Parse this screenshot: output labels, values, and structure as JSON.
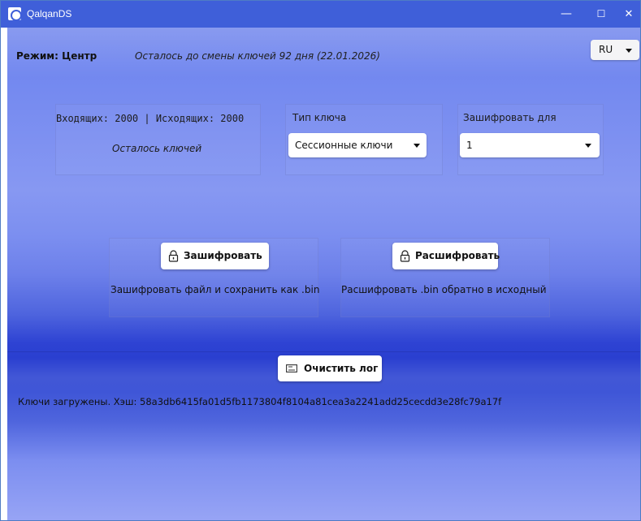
{
  "window": {
    "title": "QalqanDS",
    "controls": {
      "minimize": "—",
      "maximize": "☐",
      "close": "✕"
    }
  },
  "header": {
    "mode_label": "Режим: Центр",
    "keys_change_notice": "Осталось до смены ключей 92 дня (22.01.2026)",
    "language": {
      "selected": "RU"
    }
  },
  "keys_panel": {
    "counts": "Входящих: 2000 | Исходящих: 2000",
    "caption": "Осталось ключей"
  },
  "key_type": {
    "label": "Тип ключа",
    "selected": "Сессионные ключи"
  },
  "encrypt_for": {
    "label": "Зашифровать для",
    "selected": "1"
  },
  "encrypt": {
    "button_label": "Зашифровать",
    "description": "Зашифровать файл и сохранить как .bin"
  },
  "decrypt": {
    "button_label": "Расшифровать",
    "description": "Расшифровать .bin обратно в исходный"
  },
  "log": {
    "clear_button_label": "Очистить лог",
    "message": "Ключи загружены. Хэш: 58a3db6415fa01d5fb1173804f8104a81cea3a2241add25cecdd3e28fc79a17f"
  },
  "colors": {
    "titlebar": "#3f5fd9",
    "gradient_top": "#7187ef",
    "gradient_dark_band": "#2a3fd0",
    "gradient_bottom": "#97a4f5"
  }
}
